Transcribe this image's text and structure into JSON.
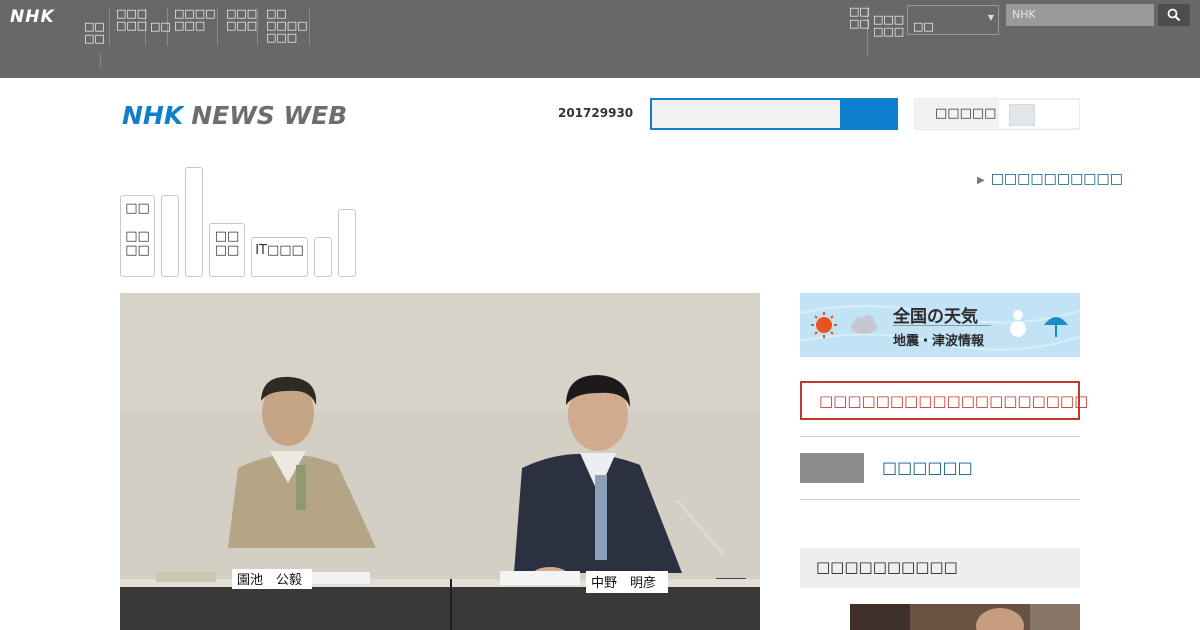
{
  "global_bar": {
    "logo": "NHK",
    "nav": [
      "□□\n□□",
      "□□□\n□□□",
      "□□",
      "□□□□\n□□□",
      "□□□\n□□□",
      "□□\n□□□□\n□□□"
    ],
    "right_nav": [
      "□□\n□□",
      "□□□\n□□□"
    ],
    "select_value": "□□",
    "search_placeholder": "NHK"
  },
  "header": {
    "logo_nhk": "NHK",
    "logo_news": "NEWS WEB",
    "date": "201729930",
    "switch_label": "□□□□□"
  },
  "top_link": "□□□□□□□□□□",
  "categories": [
    {
      "label": "□□\n\n□□\n□□"
    },
    {
      "label": ""
    },
    {
      "label": ""
    },
    {
      "label": "□□\n□□"
    },
    {
      "label": "IT□□□"
    },
    {
      "label": ""
    },
    {
      "label": ""
    }
  ],
  "photo": {
    "nameplate_left": "園池　公毅",
    "nameplate_right": "中野　明彦"
  },
  "sidebar": {
    "weather_title": "全国の天気",
    "weather_sub": "地震・津波情報",
    "red_box": "□□□□□□□□□□□□□□□□□□□",
    "gray_link": "□□□□□□",
    "section_head": "□□□□□□□□□□"
  },
  "colors": {
    "global_bar": "#686868",
    "brand_blue": "#0c7fce",
    "link_blue": "#0b5a86",
    "alert_red": "#c0392b"
  }
}
